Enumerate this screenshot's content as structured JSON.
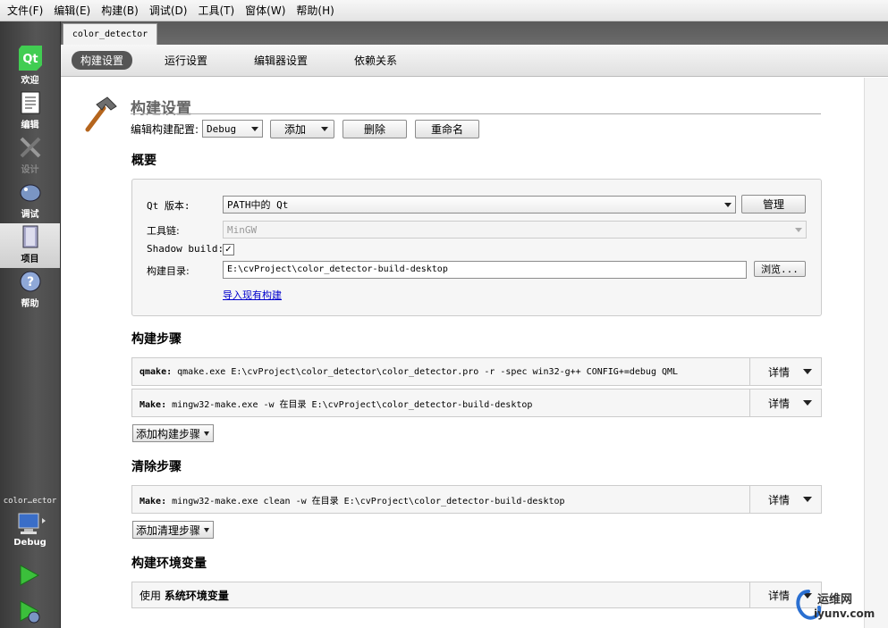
{
  "menu": [
    "文件(F)",
    "编辑(E)",
    "构建(B)",
    "调试(D)",
    "工具(T)",
    "窗体(W)",
    "帮助(H)"
  ],
  "modes": [
    {
      "label": "欢迎",
      "icon": "qt-logo-icon",
      "state": "normal"
    },
    {
      "label": "编辑",
      "icon": "document-icon",
      "state": "normal"
    },
    {
      "label": "设计",
      "icon": "design-tools-icon",
      "state": "disabled"
    },
    {
      "label": "调试",
      "icon": "debug-icon",
      "state": "normal"
    },
    {
      "label": "项目",
      "icon": "project-icon",
      "state": "active"
    },
    {
      "label": "帮助",
      "icon": "help-icon",
      "state": "normal"
    }
  ],
  "target": {
    "project": "color…ector",
    "config": "Debug"
  },
  "file_tab": "color_detector",
  "subtabs": [
    "构建设置",
    "运行设置",
    "编辑器设置",
    "依赖关系"
  ],
  "page_title": "构建设置",
  "config_row": {
    "label": "编辑构建配置:",
    "selected": "Debug",
    "add": "添加",
    "delete": "删除",
    "rename": "重命名"
  },
  "overview": {
    "heading": "概要",
    "qt_label": "Qt 版本:",
    "qt_value": "PATH中的 Qt",
    "manage": "管理",
    "toolchain_label": "工具链:",
    "toolchain_value": "MinGW",
    "shadow_label": "Shadow build:",
    "shadow_checked": "✓",
    "dir_label": "构建目录:",
    "dir_value": "E:\\cvProject\\color_detector-build-desktop",
    "browse": "浏览...",
    "import_link": "导入现有构建"
  },
  "build_steps": {
    "heading": "构建步骤",
    "steps": [
      {
        "name": "qmake:",
        "cmd": " qmake.exe E:\\cvProject\\color_detector\\color_detector.pro -r -spec win32-g++ CONFIG+=debug QML"
      },
      {
        "name": "Make:",
        "cmd": " mingw32-make.exe -w 在目录 E:\\cvProject\\color_detector-build-desktop"
      }
    ],
    "add": "添加构建步骤"
  },
  "clean_steps": {
    "heading": "清除步骤",
    "steps": [
      {
        "name": "Make:",
        "cmd": " mingw32-make.exe clean -w 在目录 E:\\cvProject\\color_detector-build-desktop"
      }
    ],
    "add": "添加清理步骤"
  },
  "env": {
    "heading": "构建环境变量",
    "use": "使用",
    "value": "系统环境变量"
  },
  "detail_label": "详情",
  "watermark": {
    "line1": "运维网",
    "line2": "iyunv.com"
  }
}
